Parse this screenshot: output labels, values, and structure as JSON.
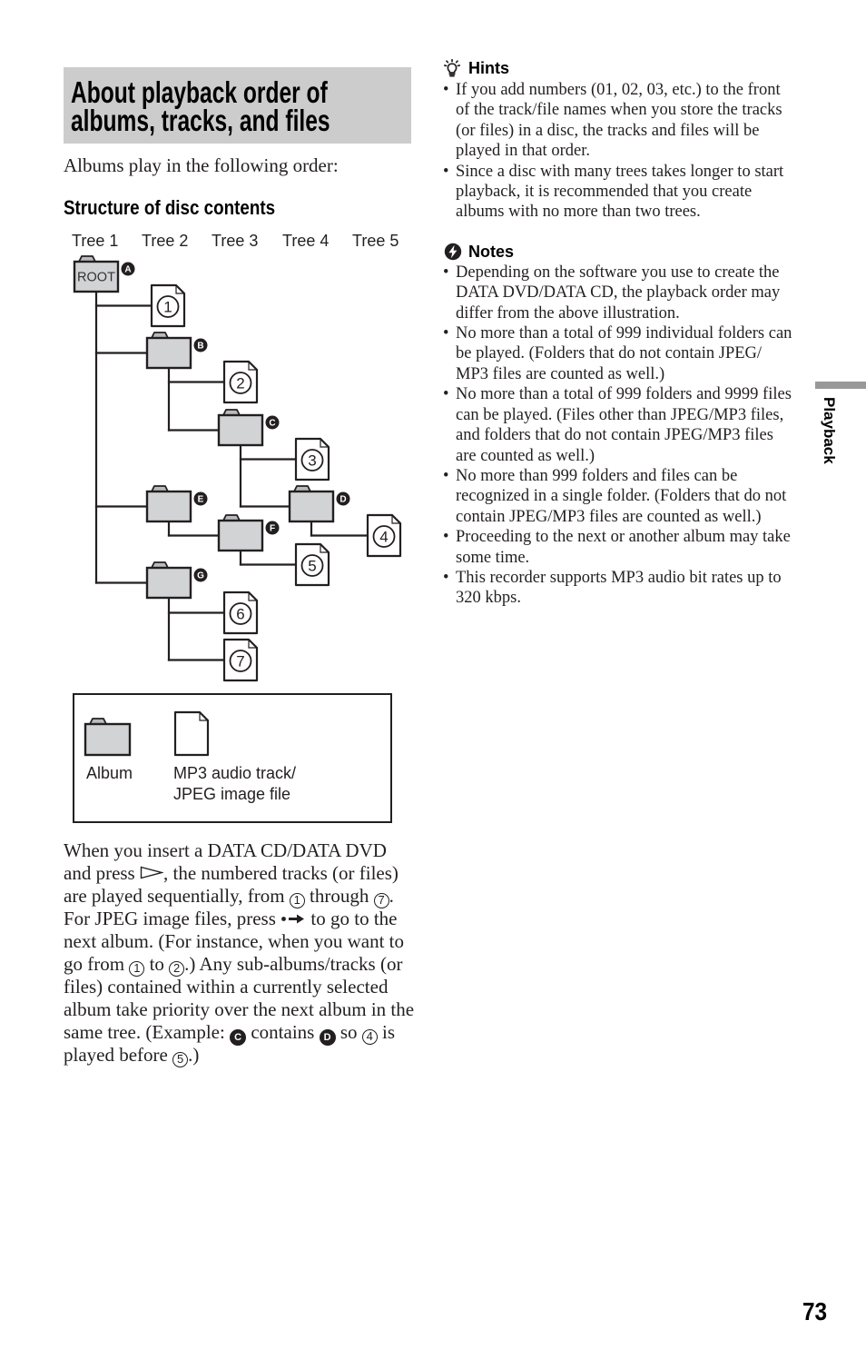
{
  "page": {
    "number": "73",
    "section_tab": "Playback"
  },
  "colors": {
    "ink": "#231f20",
    "folder_fill": "#d1d3d4",
    "folder_tab": "#b9bbbd",
    "title_bg": "#cccccc",
    "side_tab": "#999999"
  },
  "title": {
    "lines": [
      "About playback order of",
      "albums, tracks, and files"
    ]
  },
  "intro": "Albums play in the following order:",
  "structure_heading": "Structure of disc contents",
  "diagram": {
    "tree_labels": [
      "Tree 1",
      "Tree 2",
      "Tree 3",
      "Tree 4",
      "Tree 5"
    ],
    "nodes": [
      {
        "id": "A",
        "type": "folder",
        "badge": "A",
        "label": "ROOT",
        "parent": null,
        "tree": 1
      },
      {
        "id": "1",
        "type": "file",
        "number": "1",
        "parent": "A",
        "tree": 2
      },
      {
        "id": "B",
        "type": "folder",
        "badge": "B",
        "parent": "A",
        "tree": 2
      },
      {
        "id": "2",
        "type": "file",
        "number": "2",
        "parent": "B",
        "tree": 3
      },
      {
        "id": "C",
        "type": "folder",
        "badge": "C",
        "parent": "B",
        "tree": 3
      },
      {
        "id": "3",
        "type": "file",
        "number": "3",
        "parent": "C",
        "tree": 4
      },
      {
        "id": "D",
        "type": "folder",
        "badge": "D",
        "parent": "C",
        "tree": 4
      },
      {
        "id": "4",
        "type": "file",
        "number": "4",
        "parent": "D",
        "tree": 5
      },
      {
        "id": "E",
        "type": "folder",
        "badge": "E",
        "parent": "A",
        "tree": 2
      },
      {
        "id": "F",
        "type": "folder",
        "badge": "F",
        "parent": "E",
        "tree": 3
      },
      {
        "id": "5",
        "type": "file",
        "number": "5",
        "parent": "F",
        "tree": 4
      },
      {
        "id": "G",
        "type": "folder",
        "badge": "G",
        "parent": "A",
        "tree": 2
      },
      {
        "id": "6",
        "type": "file",
        "number": "6",
        "parent": "G",
        "tree": 3
      },
      {
        "id": "7",
        "type": "file",
        "number": "7",
        "parent": "G",
        "tree": 3
      }
    ],
    "legend": {
      "album_label": "Album",
      "file_label_lines": [
        "MP3 audio track/",
        "JPEG image file"
      ]
    }
  },
  "body_lines": [
    [
      {
        "text": "When you insert a DATA CD/DATA DVD"
      }
    ],
    [
      {
        "text": "and press "
      },
      {
        "icon": "play-button"
      },
      {
        "text": ", the numbered tracks (or files)"
      }
    ],
    [
      {
        "text": "are played sequentially, from "
      },
      {
        "circled": "1"
      },
      {
        "text": " through "
      },
      {
        "circled": "7"
      },
      {
        "text": "."
      }
    ],
    [
      {
        "text": "For JPEG image files, press "
      },
      {
        "icon": "next-album"
      },
      {
        "text": " to go to the"
      }
    ],
    [
      {
        "text": "next album. (For instance, when you want to"
      }
    ],
    [
      {
        "text": "go from "
      },
      {
        "circled": "1"
      },
      {
        "text": " to "
      },
      {
        "circled": "2"
      },
      {
        "text": ".) Any sub-albums/tracks (or"
      }
    ],
    [
      {
        "text": "files) contained within a currently selected"
      }
    ],
    [
      {
        "text": "album take priority over the next album in the"
      }
    ],
    [
      {
        "text": "same tree. (Example: "
      },
      {
        "badge": "C"
      },
      {
        "text": " contains "
      },
      {
        "badge": "D"
      },
      {
        "text": " so "
      },
      {
        "circled": "4"
      },
      {
        "text": " is"
      }
    ],
    [
      {
        "text": "played before "
      },
      {
        "circled": "5"
      },
      {
        "text": ".)"
      }
    ]
  ],
  "hints": {
    "heading": "Hints",
    "bullet_glyph": "•",
    "items": [
      {
        "lines": [
          "If you add numbers (01, 02, 03, etc.) to the front",
          "of the track/file names when you store the tracks",
          "(or files) in a disc, the tracks and files will be",
          "played in that order."
        ]
      },
      {
        "lines": [
          "Since a disc with many trees takes longer to start",
          "playback, it is recommended that you create",
          "albums with no more than two trees."
        ]
      }
    ]
  },
  "notes": {
    "heading": "Notes",
    "bullet_glyph": "•",
    "items": [
      {
        "lines": [
          "Depending on the software you use to create the",
          "DATA DVD/DATA CD, the playback order may",
          "differ from the above illustration."
        ]
      },
      {
        "lines": [
          "No more than a total of 999 individual folders can",
          "be played. (Folders that do not contain JPEG/",
          "MP3 files are counted as well.)"
        ]
      },
      {
        "lines": [
          "No more than a total of 999 folders and 9999 files",
          "can be played. (Files other than JPEG/MP3 files,",
          "and folders that do not contain JPEG/MP3 files",
          "are counted as well.)"
        ]
      },
      {
        "lines": [
          "No more than 999 folders and files can be",
          "recognized in a single folder. (Folders that do not",
          "contain JPEG/MP3 files are counted as well.)"
        ]
      },
      {
        "lines": [
          "Proceeding to the next or another album may take",
          "some time."
        ]
      },
      {
        "lines": [
          "This recorder supports MP3 audio bit rates up to",
          "320 kbps."
        ]
      }
    ]
  }
}
